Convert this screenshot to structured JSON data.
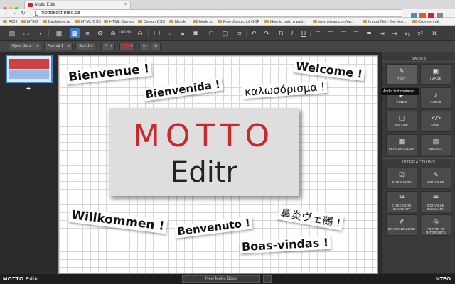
{
  "browser": {
    "tab_title": "Motto Editr",
    "tab_close": "×",
    "url": "mottoeditr.nteo.ca",
    "bookmarks": [
      "AQIII",
      "NTEO",
      "Backbone.js",
      "HTML/CSS",
      "HTML Canvas",
      "Design CSS",
      "Mobile",
      "Node.js",
      "Free Javascript OOP",
      "How to build a web...",
      "waynejean.com/up...",
      "Import.Net - Service...",
      "Croyvommé"
    ]
  },
  "toolbar": {
    "zoom": "100 %",
    "font_family": "Open Sans",
    "format": "Format 1",
    "size": "Size 1"
  },
  "canvas": {
    "words": {
      "bienvenue": "Bienvenue !",
      "bienvenida": "Bienvenida !",
      "welcome": "Welcome !",
      "greek": "καλωσόρισμα !",
      "willkommen": "Willkommen !",
      "benvenuto": "Benvenuto !",
      "boas": "Boas-vindas !",
      "japanese": "鼻炎ヴェ鵺 !"
    },
    "logo_top": "MOTTO",
    "logo_bottom": "Editr"
  },
  "panel": {
    "bases_title": "BASES",
    "interactions_title": "INTERACTIONS",
    "bases": [
      "TEXT",
      "IMAGE",
      "VIDEO",
      "AUDIO",
      "IFRAME",
      "HTML",
      "PLACEHOLDER",
      "WIDGET"
    ],
    "interactions": [
      "CHECKBOX",
      "EDITABLE",
      "CHECKBOX SUMMARY",
      "EDITABLE SUMMARY",
      "DRAWING ZONE",
      "POINTS OF INTERESTS"
    ],
    "tooltip": "Add a text container"
  },
  "footer": {
    "brand_bold": "MOTTO",
    "brand_rest": " Editr",
    "book": "New Motto Book",
    "right_brand": "NTEO"
  },
  "colors": {
    "accent": "#3a7bc1",
    "brand_red": "#c8292e"
  }
}
